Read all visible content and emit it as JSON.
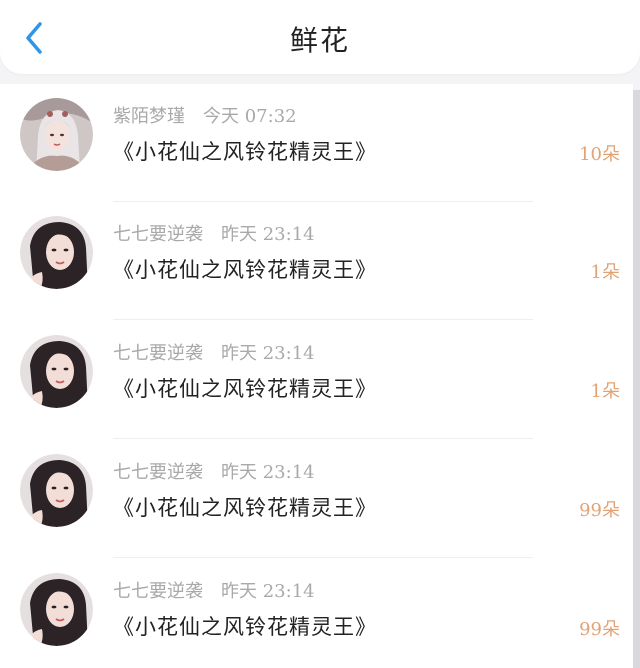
{
  "header": {
    "title": "鲜花",
    "back_icon": "chevron-left-icon",
    "accent": "#2f95e8"
  },
  "list": {
    "items": [
      {
        "name": "紫陌梦瑾",
        "time": "今天 07:32",
        "gift": "《小花仙之风铃花精灵王》",
        "count": "10朵",
        "avatar": "avatar-girl-white-hair"
      },
      {
        "name": "七七要逆袭",
        "time": "昨天 23:14",
        "gift": "《小花仙之风铃花精灵王》",
        "count": "1朵",
        "avatar": "avatar-girl-dark-hair"
      },
      {
        "name": "七七要逆袭",
        "time": "昨天 23:14",
        "gift": "《小花仙之风铃花精灵王》",
        "count": "1朵",
        "avatar": "avatar-girl-dark-hair"
      },
      {
        "name": "七七要逆袭",
        "time": "昨天 23:14",
        "gift": "《小花仙之风铃花精灵王》",
        "count": "99朵",
        "avatar": "avatar-girl-dark-hair"
      },
      {
        "name": "七七要逆袭",
        "time": "昨天 23:14",
        "gift": "《小花仙之风铃花精灵王》",
        "count": "99朵",
        "avatar": "avatar-girl-dark-hair"
      }
    ]
  },
  "colors": {
    "count": "#e2a274",
    "meta": "#a9a9a9",
    "title": "#222222"
  }
}
